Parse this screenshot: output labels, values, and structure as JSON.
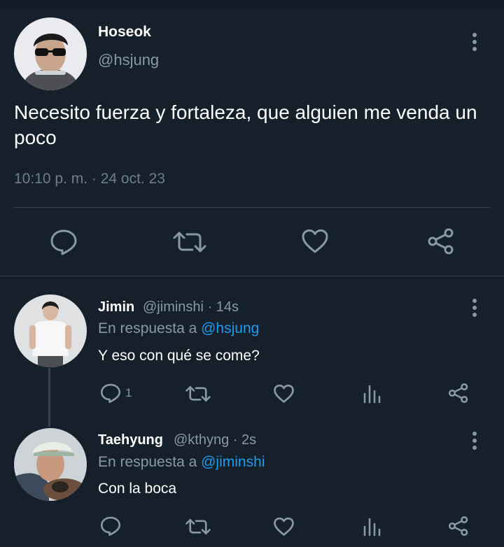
{
  "main_tweet": {
    "display_name": "Hoseok",
    "handle": "@hsjung",
    "text": "Necesito fuerza y fortaleza, que alguien me venda un poco",
    "timestamp": "10:10 p. m. · 24 oct. 23",
    "actions": [
      "reply-icon",
      "retweet-icon",
      "like-icon",
      "share-icon"
    ]
  },
  "replies": [
    {
      "display_name": "Jimin",
      "handle_time": "@jiminshi · 14s",
      "reply_prefix": "En respuesta a",
      "reply_to": "@hsjung",
      "text": "Y eso con qué se come?",
      "reply_count": "1",
      "actions": [
        "reply-icon",
        "retweet-icon",
        "like-icon",
        "analytics-icon",
        "share-icon"
      ]
    },
    {
      "display_name": "Taehyung",
      "handle_time": "@kthyng · 2s",
      "reply_prefix": "En respuesta a",
      "reply_to": "@jiminshi",
      "text": "Con la boca",
      "actions": [
        "reply-icon",
        "retweet-icon",
        "like-icon",
        "analytics-icon",
        "share-icon"
      ]
    }
  ],
  "colors": {
    "background": "#15202b",
    "muted_text": "#8899a6",
    "mention": "#1d9bf0",
    "divider": "#38444d"
  }
}
